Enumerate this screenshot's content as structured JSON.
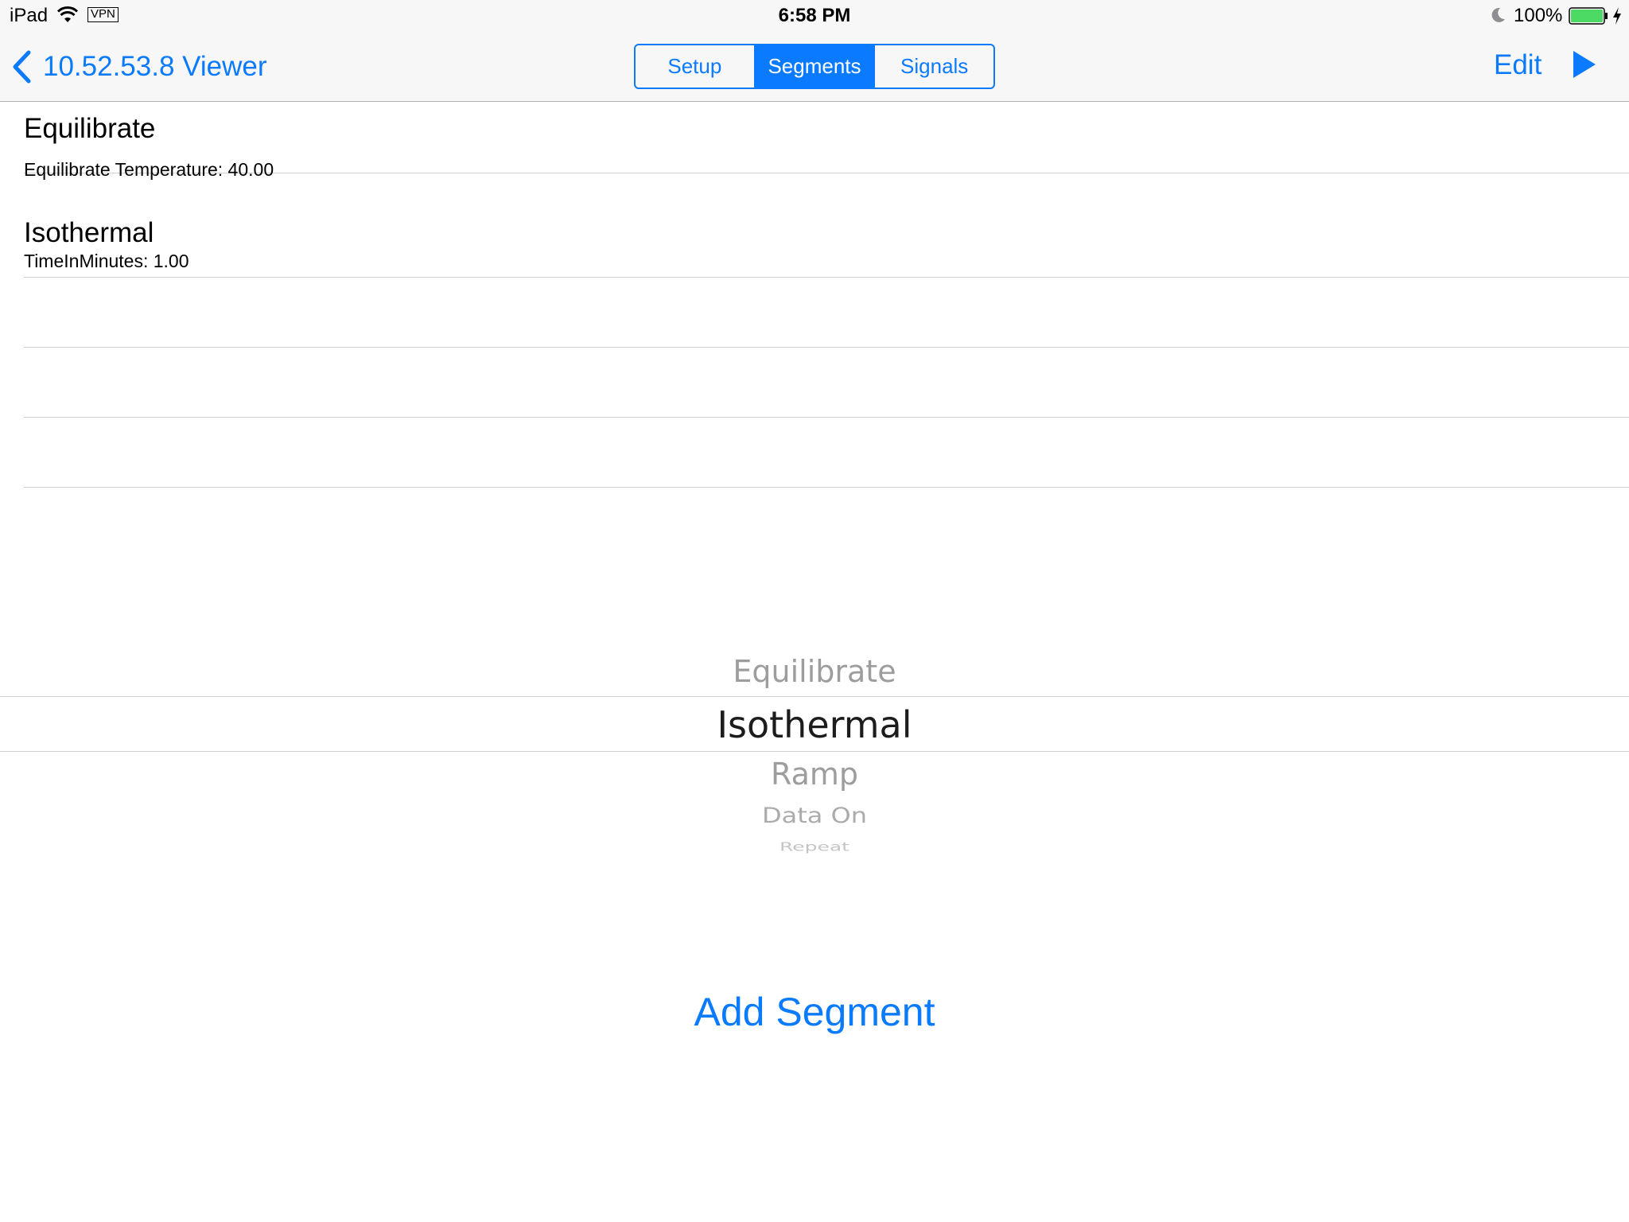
{
  "status_bar": {
    "device": "iPad",
    "vpn": "VPN",
    "time": "6:58 PM",
    "battery_percent": "100%",
    "icons": [
      "wifi-icon",
      "moon-icon",
      "battery-icon",
      "charging-bolt-icon"
    ]
  },
  "nav": {
    "back_label": "10.52.53.8 Viewer",
    "tabs": [
      "Setup",
      "Segments",
      "Signals"
    ],
    "active_tab": "Segments",
    "edit_label": "Edit",
    "accent_color": "#0a7aff"
  },
  "segments": [
    {
      "title": "Equilibrate",
      "detail": "Equilibrate Temperature: 40.00"
    },
    {
      "title": "Isothermal",
      "detail": "TimeInMinutes: 1.00"
    }
  ],
  "picker": {
    "options": [
      "Equilibrate",
      "Isothermal",
      "Ramp",
      "Data On",
      "Repeat"
    ],
    "selected": "Isothermal"
  },
  "add_segment_label": "Add Segment"
}
